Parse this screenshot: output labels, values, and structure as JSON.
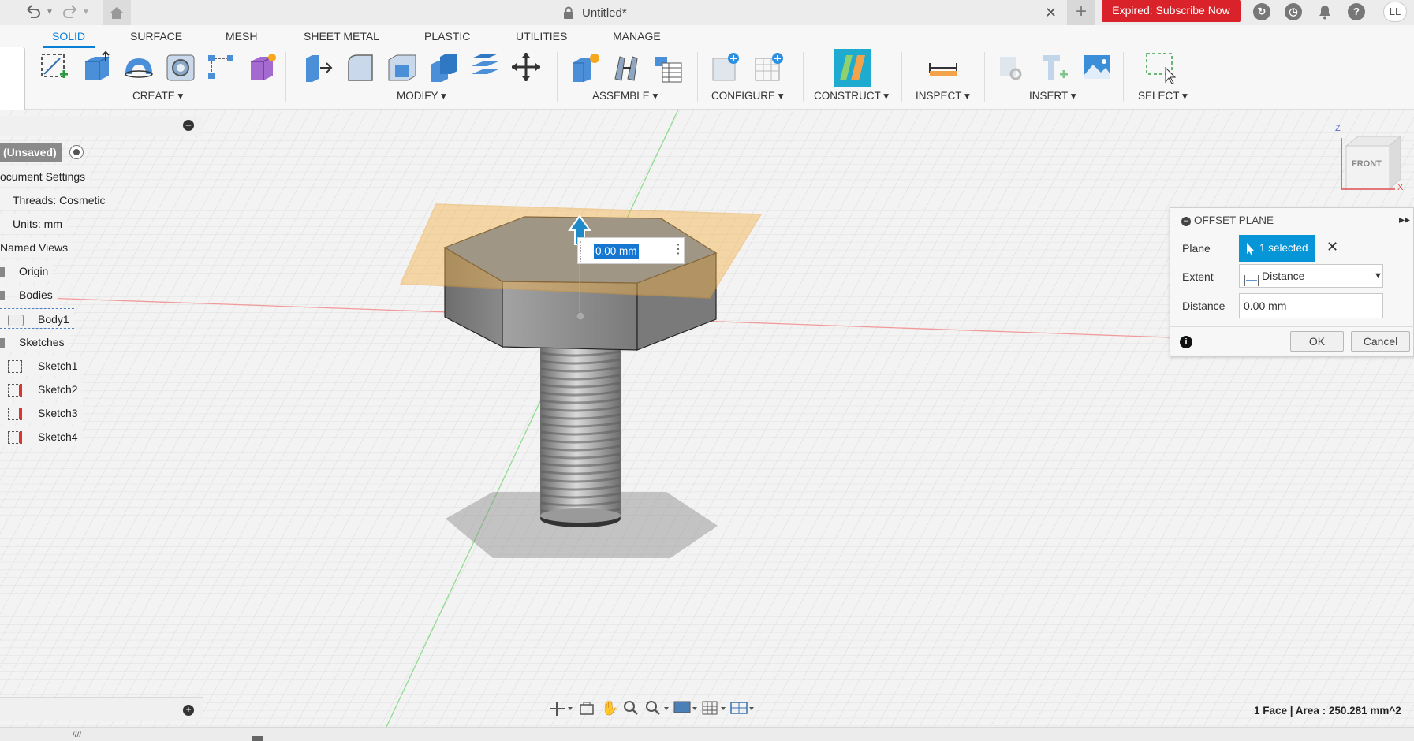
{
  "window": {
    "title": "Untitled*",
    "subscribe_label": "Expired: Subscribe Now",
    "user_initials": "LL"
  },
  "ribbon": {
    "tabs": [
      "SOLID",
      "SURFACE",
      "MESH",
      "SHEET METAL",
      "PLASTIC",
      "UTILITIES",
      "MANAGE"
    ],
    "active_tab": "SOLID",
    "groups": [
      "CREATE",
      "MODIFY",
      "ASSEMBLE",
      "CONFIGURE",
      "CONSTRUCT",
      "INSPECT",
      "INSERT",
      "SELECT"
    ]
  },
  "browser": {
    "root": "(Unsaved)",
    "items": [
      "ocument Settings",
      "Threads: Cosmetic",
      "Units: mm",
      "Named Views",
      "Origin",
      "Bodies",
      "Body1",
      "Sketches",
      "Sketch1",
      "Sketch2",
      "Sketch3",
      "Sketch4"
    ]
  },
  "dialog": {
    "title": "OFFSET PLANE",
    "plane_label": "Plane",
    "plane_value": "1 selected",
    "extent_label": "Extent",
    "extent_value": "Distance",
    "distance_label": "Distance",
    "distance_value": "0.00 mm",
    "ok_label": "OK",
    "cancel_label": "Cancel"
  },
  "viewport": {
    "inline_distance": "0.00 mm",
    "viewcube_face": "FRONT",
    "axis_x": "X",
    "axis_z": "Z"
  },
  "status_bar": {
    "selection_info": "1 Face | Area : 250.281 mm^2"
  },
  "colors": {
    "accent": "#0a7fd6",
    "subscribe_bg": "#d9222a",
    "selection_blue": "#0696d7",
    "face_highlight": "#5b7fb8",
    "plane_orange": "#f4b24a"
  }
}
